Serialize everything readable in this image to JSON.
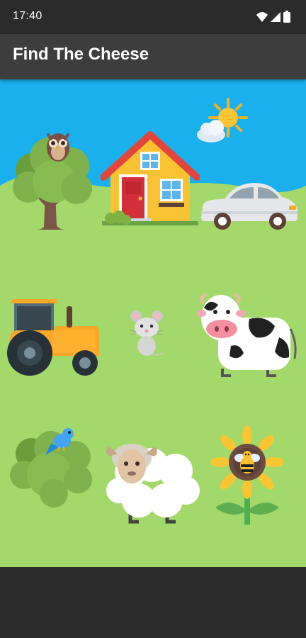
{
  "status_bar": {
    "time": "17:40",
    "icons": [
      "wifi-icon",
      "cell-signal-icon",
      "battery-icon"
    ]
  },
  "app_bar": {
    "title": "Find The Cheese"
  },
  "scene": {
    "colors": {
      "sky": "#1ab0ee",
      "grass": "#a3d96a",
      "hill": "#8ccc4e",
      "app_bar": "#3d3d3d",
      "status_bar": "#2b2b2b"
    },
    "items": [
      "tree-with-owl",
      "house",
      "car",
      "sun-with-cloud",
      "tractor",
      "mouse",
      "cow",
      "bush-with-bird",
      "sheep",
      "sunflower-with-bee"
    ]
  }
}
